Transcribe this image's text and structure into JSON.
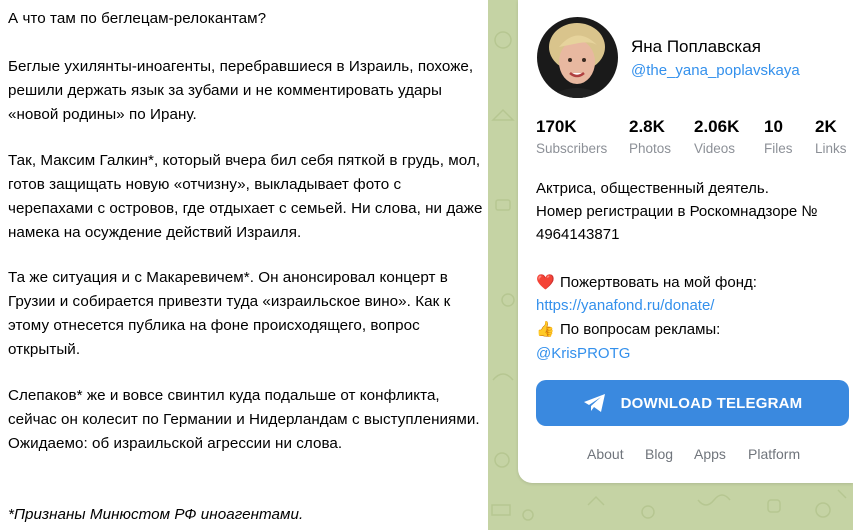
{
  "post": {
    "heading": "А что там по беглецам-релокантам?",
    "paragraphs": [
      "Беглые ухилянты-иноагенты, перебравшиеся в Израиль, похоже, решили держать язык за зубами и не комментировать удары «новой родины» по Ирану.",
      "Так, Максим Галкин*, который вчера бил себя пяткой в грудь, мол, готов защищать новую «отчизну», выкладывает фото с черепахами с островов, где отдыхает с семьей. Ни слова, ни даже намека на осуждение действий Израиля.",
      "Та же ситуация и с Макаревичем*. Он анонсировал концерт в Грузии и собирается привезти туда «израильское вино». Как к этому отнесется публика на фоне происходящего, вопрос открытый.",
      "Слепаков* же и вовсе свинтил куда подальше от конфликта, сейчас он колесит по Германии и Нидерландам с выступлениями. Ожидаемо: об израильской агрессии ни слова."
    ],
    "footnote": "*Признаны Минюстом РФ иноагентами."
  },
  "channel": {
    "name": "Яна Поплавская",
    "username": "@the_yana_poplavskaya",
    "avatar_icon": "avatar-photo",
    "stats": [
      {
        "value": "170K",
        "label": "Subscribers"
      },
      {
        "value": "2.8K",
        "label": "Photos"
      },
      {
        "value": "2.06K",
        "label": "Videos"
      },
      {
        "value": "10",
        "label": "Files"
      },
      {
        "value": "2K",
        "label": "Links"
      }
    ],
    "description_line1": "Актриса, общественный деятель.",
    "description_line2": "Номер регистрации в Роскомнадзоре №",
    "description_line3": "4964143871",
    "donate_emoji": "❤️",
    "donate_text": "Пожертвовать на мой фонд:",
    "donate_link": "https://yanafond.ru/donate/",
    "ads_emoji": "👍",
    "ads_text": "По вопросам рекламы:",
    "ads_link": "@KrisPROTG"
  },
  "download_button": {
    "label": "DOWNLOAD TELEGRAM",
    "icon": "telegram-plane-icon"
  },
  "footer": {
    "links": [
      "About",
      "Blog",
      "Apps",
      "Platform"
    ]
  },
  "colors": {
    "accent": "#3390ec",
    "button": "#3a89df",
    "background": "#c5d3a4",
    "muted": "#8c9097"
  }
}
